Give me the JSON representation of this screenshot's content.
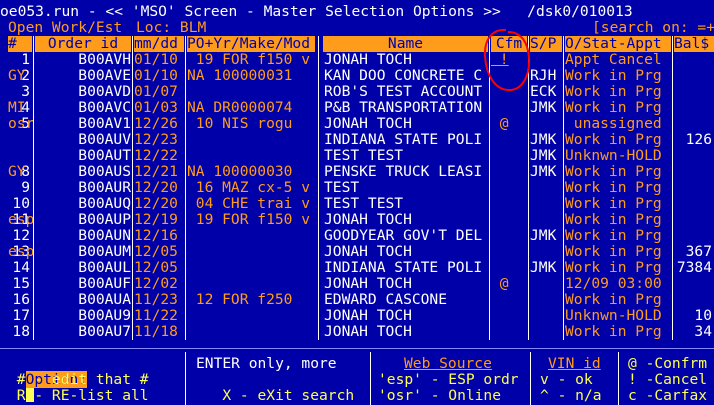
{
  "title": "oe053.run - << 'MSO' Screen - Master Selection Options >>   /dsk0/010013",
  "status": {
    "open": "Open Work/Est",
    "loc": "Loc: BLM",
    "search": "[search on: =+"
  },
  "headers": [
    "#",
    "Order id",
    "mm/dd",
    "PO+Yr/Make/Mod",
    "Name",
    "Cfm",
    "S/P",
    "O/Stat-Appt",
    "Bal$"
  ],
  "rows": [
    {
      "n": "1",
      "f": "",
      "id": "B00AVH",
      "date": "01/10",
      "po": " 19 FOR f150 v",
      "name": "JONAH TOCH",
      "cfm": " !",
      "sp": "",
      "stat": "Appt Cancel",
      "bal": ""
    },
    {
      "n": "2",
      "f": "GY",
      "id": "B00AVE",
      "date": "01/10",
      "po": "NA 100000031",
      "name": "KAN DOO CONCRETE C",
      "cfm": "",
      "sp": "RJH",
      "stat": "Work in Prg",
      "bal": ""
    },
    {
      "n": "3",
      "f": "",
      "id": "B00AVD",
      "date": "01/07",
      "po": "",
      "name": "ROB'S TEST ACCOUNT",
      "cfm": "",
      "sp": "ECK",
      "stat": "Work in Prg",
      "bal": ""
    },
    {
      "n": "4",
      "f": "MI",
      "id": "B00AVC",
      "date": "01/03",
      "po": "NA DR0000074",
      "name": "P&B TRANSPORTATION",
      "cfm": "",
      "sp": "JMK",
      "stat": "Work in Prg",
      "bal": ""
    },
    {
      "n": "5",
      "f": "osr",
      "id": "B00AV1",
      "date": "12/26",
      "po": " 10 NIS rogu",
      "name": "JONAH TOCH",
      "cfm": " @",
      "sp": "",
      "stat": " unassigned",
      "bal": ""
    },
    {
      "n": "",
      "f": "",
      "id": "B00AUV",
      "date": "12/23",
      "po": "",
      "name": "INDIANA STATE POLI",
      "cfm": "",
      "sp": "JMK",
      "stat": "Work in Prg",
      "bal": "126"
    },
    {
      "n": "",
      "f": "",
      "id": "B00AUT",
      "date": "12/22",
      "po": "",
      "name": "TEST TEST",
      "cfm": "",
      "sp": "JMK",
      "stat": "Unknwn-HOLD",
      "bal": ""
    },
    {
      "n": "8",
      "f": "GY",
      "id": "B00AUS",
      "date": "12/21",
      "po": "NA 100000030",
      "name": "PENSKE TRUCK LEASI",
      "cfm": "",
      "sp": "JMK",
      "stat": "Work in Prg",
      "bal": ""
    },
    {
      "n": "9",
      "f": "",
      "id": "B00AUR",
      "date": "12/20",
      "po": " 16 MAZ cx-5 v",
      "name": "TEST",
      "cfm": "",
      "sp": "",
      "stat": "Work in Prg",
      "bal": ""
    },
    {
      "n": "10",
      "f": "",
      "id": "B00AUQ",
      "date": "12/20",
      "po": " 04 CHE trai v",
      "name": "TEST TEST",
      "cfm": "",
      "sp": "",
      "stat": "Work in Prg",
      "bal": ""
    },
    {
      "n": "11",
      "f": "esp",
      "id": "B00AUP",
      "date": "12/19",
      "po": " 19 FOR f150 v",
      "name": "JONAH TOCH",
      "cfm": "",
      "sp": "",
      "stat": "Work in Prg",
      "bal": ""
    },
    {
      "n": "12",
      "f": "",
      "id": "B00AUN",
      "date": "12/16",
      "po": "",
      "name": "GOODYEAR GOV'T DEL",
      "cfm": "",
      "sp": "JMK",
      "stat": "Work in Prg",
      "bal": ""
    },
    {
      "n": "13",
      "f": "esp",
      "id": "B00AUM",
      "date": "12/05",
      "po": "",
      "name": "JONAH TOCH",
      "cfm": "",
      "sp": "",
      "stat": "Work in Prg",
      "bal": "367"
    },
    {
      "n": "14",
      "f": "",
      "id": "B00AUL",
      "date": "12/05",
      "po": "",
      "name": "INDIANA STATE POLI",
      "cfm": "",
      "sp": "JMK",
      "stat": "Work in Prg",
      "bal": "7384"
    },
    {
      "n": "15",
      "f": "",
      "id": "B00AUF",
      "date": "12/02",
      "po": "",
      "name": "JONAH TOCH",
      "cfm": " @",
      "sp": "",
      "stat": "12/09 03:00",
      "bal": ""
    },
    {
      "n": "16",
      "f": "",
      "id": "B00AUA",
      "date": "11/23",
      "po": " 12 FOR f250",
      "name": "EDWARD CASCONE",
      "cfm": "",
      "sp": "",
      "stat": "Work in Prg",
      "bal": ""
    },
    {
      "n": "17",
      "f": "",
      "id": "B00AU9",
      "date": "11/22",
      "po": "",
      "name": "JONAH TOCH",
      "cfm": "",
      "sp": "",
      "stat": "Unknwn-HOLD",
      "bal": "10"
    },
    {
      "n": "18",
      "f": "",
      "id": "B00AU7",
      "date": "11/18",
      "po": "",
      "name": "JONAH TOCH",
      "cfm": "",
      "sp": "",
      "stat": "Work in Prg",
      "bal": "34"
    }
  ],
  "footer": {
    "option_label": "Option:",
    "opt1": " # - edit that #",
    "opt2": " R - RE-list all",
    "enter1": "ENTER only, more",
    "enter2": "   X - eXit search",
    "web_title": "Web Source",
    "web1": "'esp' - ESP ordr",
    "web2": "'osr' - Online",
    "vin_title": "VIN id",
    "vin1": "v - ok",
    "vin2": "^ - n/a",
    "leg1": "@ -Confrm",
    "leg2": "! -Cancel",
    "leg3": "c -Carfax"
  },
  "colors": {
    "background": "#0000a8",
    "accent": "#ff9c1c",
    "highlight": "#ffff55",
    "text": "#ffffff",
    "annotation": "#ff0000"
  }
}
